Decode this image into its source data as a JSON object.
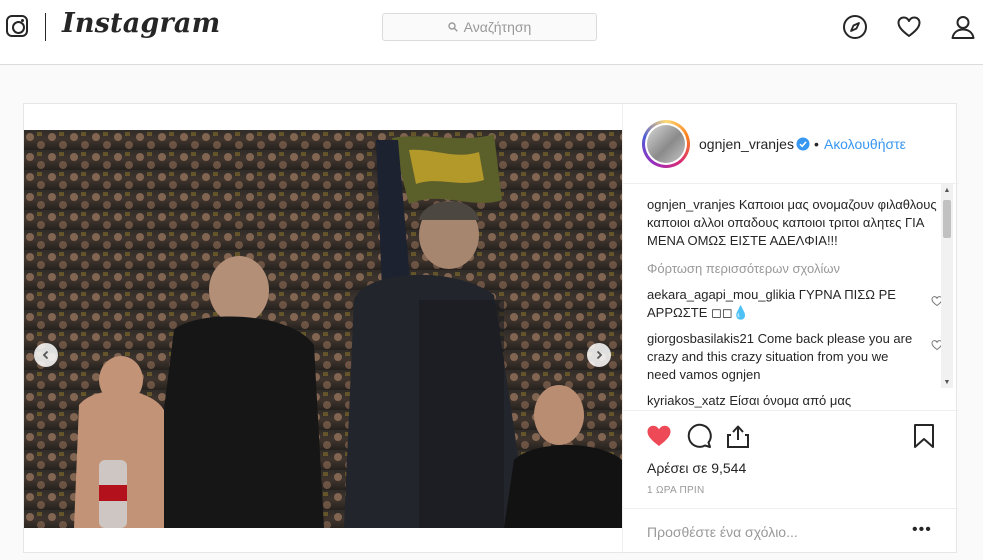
{
  "nav": {
    "brand": "Instagram",
    "search_placeholder": "Αναζήτηση",
    "icons": [
      "instagram-glyph-icon",
      "search-icon",
      "explore-compass-icon",
      "activity-heart-icon",
      "profile-icon"
    ]
  },
  "post": {
    "username": "ognjen_vranjes",
    "verified": true,
    "follow_separator": "•",
    "follow_label": "Ακολουθήστε",
    "caption_user": "ognjen_vranjes",
    "caption_text": "Καποιοι μας ονομαζουν φιλαθλους καποιοι αλλοι οπαδους καποιοι τριτοι αλητες ΓΙΑ ΜΕΝΑ ΟΜΩΣ ΕΙΣΤΕ ΑΔΕΛΦΙΑ!!!",
    "load_more": "Φόρτωση περισσότερων σχολίων",
    "comments": [
      {
        "user": "aekara_agapi_mou_glikia",
        "text": "ΓΥΡΝΑ ΠΙΣΩ ΡΕ ΑΡΡΩΣΤΕ ◻◻💧"
      },
      {
        "user": "giorgosbasilakis21",
        "text": "Come back please you are crazy and this crazy situation from you we need vamos ognjen"
      },
      {
        "user": "kyriakos_xatz",
        "text": "Είσαι όνομα από μας"
      }
    ],
    "likes_label": "Αρέσει σε 9,544",
    "timestamp": "1 ΩΡΑ ΠΡΙΝ",
    "add_comment_placeholder": "Προσθέστε ένα σχόλιο...",
    "more_options": "•••",
    "liked": true,
    "carousel": {
      "slides": 3,
      "current": 1
    }
  },
  "colors": {
    "accent": "#3897f0",
    "like": "#ed4956",
    "border": "#dbdbdb",
    "text": "#262626",
    "muted": "#999999"
  }
}
